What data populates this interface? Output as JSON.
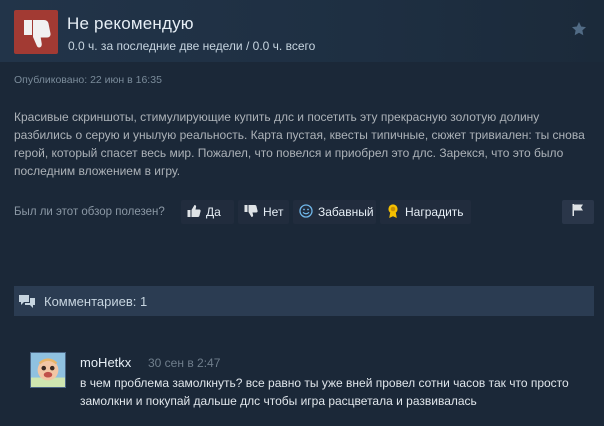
{
  "review": {
    "verdict": "Не рекомендую",
    "hours": "0.0 ч. за последние две недели / 0.0 ч. всего",
    "posted": "Опубликовано: 22 июн в 16:35",
    "text": "Красивые скриншоты, стимулирующие купить длс и посетить эту прекрасную золотую долину разбились о серую и унылую реальность. Карта пустая, квесты типичные, сюжет тривиален: ты снова герой, который спасет весь мир. Пожалел, что повелся и приобрел это длс. Зарекся, что это было последним вложением в игру."
  },
  "feedback": {
    "question": "Был ли этот обзор полезен?",
    "yes": "Да",
    "no": "Нет",
    "funny": "Забавный",
    "award": "Наградить"
  },
  "comments": {
    "header": "Комментариев: 1",
    "items": [
      {
        "author": "moHetkx",
        "time": "30 сен в 2:47",
        "text": "в чем проблема замолкнуть? все равно ты уже вней провел сотни часов так что просто замолкни и покупай дальше длс чтобы игра расцветала и развивалась"
      }
    ]
  },
  "colors": {
    "background": "#1b2838",
    "thumbs_down_bg": "#a23a33",
    "comments_bar": "#2b3c52",
    "award_icon": "#f5c000"
  },
  "icons": [
    "thumbs-down-icon",
    "star-icon",
    "thumbs-up-icon",
    "funny-face-icon",
    "award-icon",
    "flag-icon",
    "comments-icon"
  ]
}
